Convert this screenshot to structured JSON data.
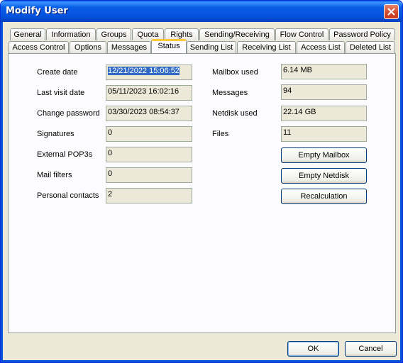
{
  "window": {
    "title": "Modify User"
  },
  "tabs_row1": [
    {
      "label": "General"
    },
    {
      "label": "Information"
    },
    {
      "label": "Groups"
    },
    {
      "label": "Quota"
    },
    {
      "label": "Rights"
    },
    {
      "label": "Sending/Receiving"
    },
    {
      "label": "Flow Control"
    },
    {
      "label": "Password Policy"
    }
  ],
  "tabs_row2": [
    {
      "label": "Access Control"
    },
    {
      "label": "Options"
    },
    {
      "label": "Messages"
    },
    {
      "label": "Status",
      "active": true
    },
    {
      "label": "Sending List"
    },
    {
      "label": "Receiving List"
    },
    {
      "label": "Access List"
    },
    {
      "label": "Deleted List"
    }
  ],
  "status": {
    "left": [
      {
        "label": "Create date",
        "value": "12/21/2022 15:06:52"
      },
      {
        "label": "Last visit date",
        "value": "05/11/2023 16:02:16"
      },
      {
        "label": "Change password",
        "value": "03/30/2023 08:54:37"
      },
      {
        "label": "Signatures",
        "value": "0"
      },
      {
        "label": "External POP3s",
        "value": "0"
      },
      {
        "label": "Mail filters",
        "value": "0"
      },
      {
        "label": "Personal contacts",
        "value": "2"
      }
    ],
    "right": [
      {
        "label": "Mailbox used",
        "value": "6.14 MB"
      },
      {
        "label": "Messages",
        "value": "94"
      },
      {
        "label": "Netdisk used",
        "value": "22.14 GB"
      },
      {
        "label": "Files",
        "value": "11"
      }
    ],
    "buttons": {
      "empty_mailbox": "Empty Mailbox",
      "empty_netdisk": "Empty Netdisk",
      "recalculation": "Recalculation"
    }
  },
  "footer": {
    "ok": "OK",
    "cancel": "Cancel"
  },
  "colors": {
    "titlebar": "#0a5fe6",
    "selection": "#316ac5",
    "active_tab_accent": "#ffc83c"
  }
}
